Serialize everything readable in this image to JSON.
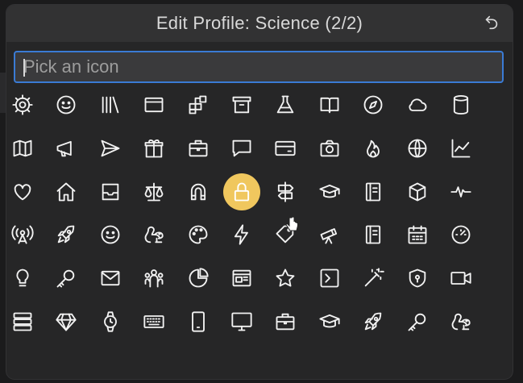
{
  "header": {
    "title": "Edit Profile: Science (2/2)"
  },
  "search": {
    "placeholder": "Pick an icon",
    "value": ""
  },
  "colors": {
    "accent": "#3a7bd5",
    "selected": "#f0c75e"
  },
  "selected_icon": "lock-icon",
  "icons": [
    [
      "gear-icon",
      "smiley-icon",
      "library-icon",
      "window-icon",
      "extensions-icon",
      "archive-icon",
      "beaker-icon",
      "book-icon",
      "compass-icon",
      "cloud-icon",
      "database-icon"
    ],
    [
      "map-icon",
      "megaphone-icon",
      "send-icon",
      "gift-icon",
      "briefcase-icon",
      "comment-icon",
      "credit-card-icon",
      "camera-icon",
      "flame-icon",
      "globe-icon",
      "graph-line-icon"
    ],
    [
      "heart-icon",
      "home-icon",
      "inbox-icon",
      "law-icon",
      "magnet-icon",
      "lock-icon",
      "signpost-icon",
      "mortar-board-icon",
      "notebook-icon",
      "package-icon",
      "pulse-icon"
    ],
    [
      "broadcast-icon",
      "rocket-icon",
      "smiley-icon",
      "squirrel-icon",
      "palette-icon",
      "zap-icon",
      "tag-icon",
      "telescope-icon",
      "notebook-icon",
      "calendar-icon",
      "dashboard-icon"
    ],
    [
      "lightbulb-icon",
      "key-icon",
      "mail-icon",
      "organization-icon",
      "pie-chart-icon",
      "preview-icon",
      "star-icon",
      "terminal-icon",
      "wand-icon",
      "shield-icon",
      "device-camera-video-icon"
    ],
    [
      "server-icon",
      "ruby-icon",
      "watch-icon",
      "keyboard-icon",
      "device-mobile-icon",
      "desktop-icon",
      "briefcase-icon",
      "mortar-board-icon",
      "rocket-icon",
      "key-icon",
      "squirrel-icon"
    ]
  ]
}
